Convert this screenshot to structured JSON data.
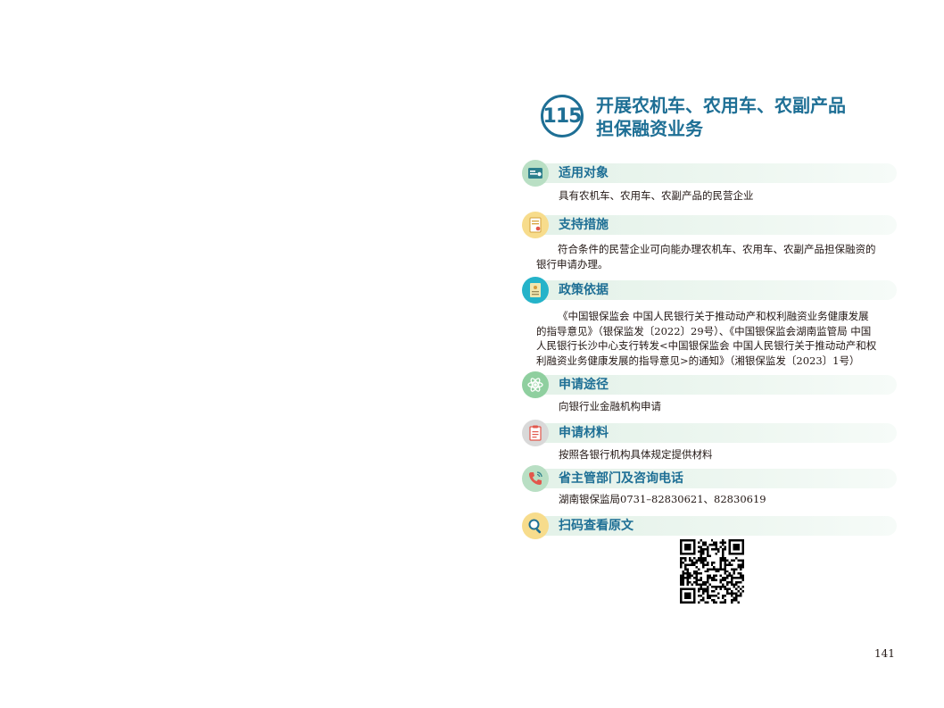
{
  "header": {
    "number": "115",
    "title_line1": "开展农机车、农用车、农副产品",
    "title_line2": "担保融资业务"
  },
  "sections": [
    {
      "title": "适用对象",
      "icon": "id-card-icon",
      "icon_color": "#b9dfc4",
      "lines": [
        "具有农机车、农用车、农副产品的民营企业"
      ]
    },
    {
      "title": "支持措施",
      "icon": "certificate-icon",
      "icon_color": "#f7dc8c",
      "lines": [
        "符合条件的民营企业可向能办理农机车、农用车、农副产品担保融资的",
        "银行申请办理。"
      ]
    },
    {
      "title": "政策依据",
      "icon": "document-icon",
      "icon_color": "#25b3c9",
      "lines": [
        "《中国银保监会 中国人民银行关于推动动产和权利融资业务健康发展",
        "的指导意见》（银保监发〔2022〕29号）、《中国银保监会湖南监管局 中国",
        "人民银行长沙中心支行转发<中国银保监会 中国人民银行关于推动动产和权",
        "利融资业务健康发展的指导意见>的通知》（湘银保监发〔2023〕1号）"
      ]
    },
    {
      "title": "申请途径",
      "icon": "atom-icon",
      "icon_color": "#8fcf9f",
      "lines": [
        "向银行业金融机构申请"
      ]
    },
    {
      "title": "申请材料",
      "icon": "clipboard-icon",
      "icon_color": "#d9d9d9",
      "lines": [
        "按照各银行机构具体规定提供材料"
      ]
    },
    {
      "title": "省主管部门及咨询电话",
      "icon": "phone-icon",
      "icon_color": "#b9dfc4",
      "lines": [
        "湖南银保监局0731–82830621、82830619"
      ]
    },
    {
      "title": "扫码查看原文",
      "icon": "search-icon",
      "icon_color": "#f7dc8c",
      "lines": []
    }
  ],
  "page_number": "141",
  "colors": {
    "accent": "#1e6f95",
    "bar": "#e3f1e8",
    "text": "#231815"
  }
}
